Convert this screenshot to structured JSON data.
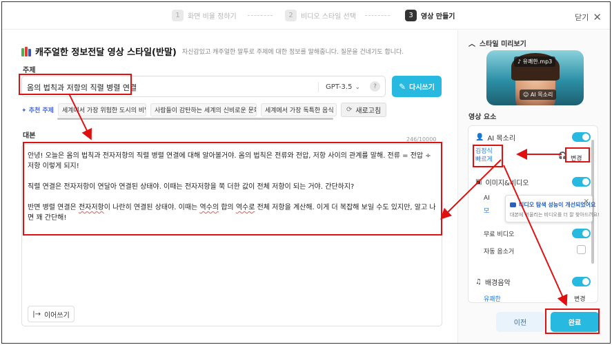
{
  "stepper": {
    "steps": [
      {
        "num": "1",
        "label": "화면 비율 정하기"
      },
      {
        "num": "2",
        "label": "비디오 스타일 선택"
      },
      {
        "num": "3",
        "label": "영상 만들기"
      }
    ],
    "close_label": "닫기"
  },
  "main": {
    "title": "캐주얼한 정보전달 영상 스타일(반말)",
    "subtitle": "자신감있고 캐주얼한 말투로 주제에 대한 정보를 말해줍니다. 질문을 건네기도 합니다.",
    "topic_label": "주제",
    "topic_value": "옴의 법칙과 저항의 직렬 병렬 연결",
    "model": "GPT-3.5",
    "help": "?",
    "rewrite_label": "다시쓰기",
    "recommend_label": "추천 주제",
    "chips": [
      "세계에서 가장 위험한 도시의 비밀",
      "사람들이 감탄하는 세계의 신비로운 문화",
      "세계에서 가장 독특한 음식 문"
    ],
    "refresh_label": "새로고침",
    "script_label": "대본",
    "counter": "246/10000",
    "script": {
      "p1": "안녕! 오늘은 옴의 법칙과 전자저항의 직렬 병렬 연결에 대해 알아볼거야. 옴의 법칙은 전류와 전압, 저항 사이의 관계를 말해. 전류 = 전압 ÷ 저항 이렇게 되지!",
      "p2": "직렬 연결은 전자저항이 연달아 연결된 상태야. 이때는 전자저항을 쭉 더한 값이 전체 저항이 되는 거야. 간단하지?",
      "p3a": "반면 병렬 연결은 ",
      "p3b": "전자저항",
      "p3c": "이 나란히 연결된 상태야. 이때는 ",
      "p3d": "역수의",
      "p3e": " 합의 ",
      "p3f": "역수로",
      "p3g": " 전체 저항을 계산해. 이게 더 복잡해 보일 수도 있지만, 알고 나면 꽤 간단해!"
    },
    "continue_label": "이어쓰기"
  },
  "side": {
    "preview_title": "스타일 미리보기",
    "music_tag": "유쾌한.mp3",
    "voice_tag": "AI 목소리",
    "elements_title": "영상 요소",
    "ai_voice_label": "AI 목소리",
    "voice_name": "김정식",
    "voice_speed": "빠르게",
    "change_label": "변경",
    "image_video_label": "이미지&비디오",
    "ai_partial": "AI",
    "link_partial": "모",
    "free_video_label": "무료 비디오",
    "auto_sound_label": "자동 음소거",
    "bgm_label": "배경음악",
    "bgm_value": "유쾌한",
    "bgm_change_label": "변경",
    "tooltip_title": "비디오 탐색 성능이 개선되었어요",
    "tooltip_body": "대본에 어울리는 비디오를 더 잘 찾아드려요!",
    "tooltip_close": "×"
  },
  "footer": {
    "prev_label": "이전",
    "done_label": "완료"
  },
  "colors": {
    "accent": "#27b9e0",
    "annotation": "#e01010",
    "link": "#2a7be4"
  }
}
